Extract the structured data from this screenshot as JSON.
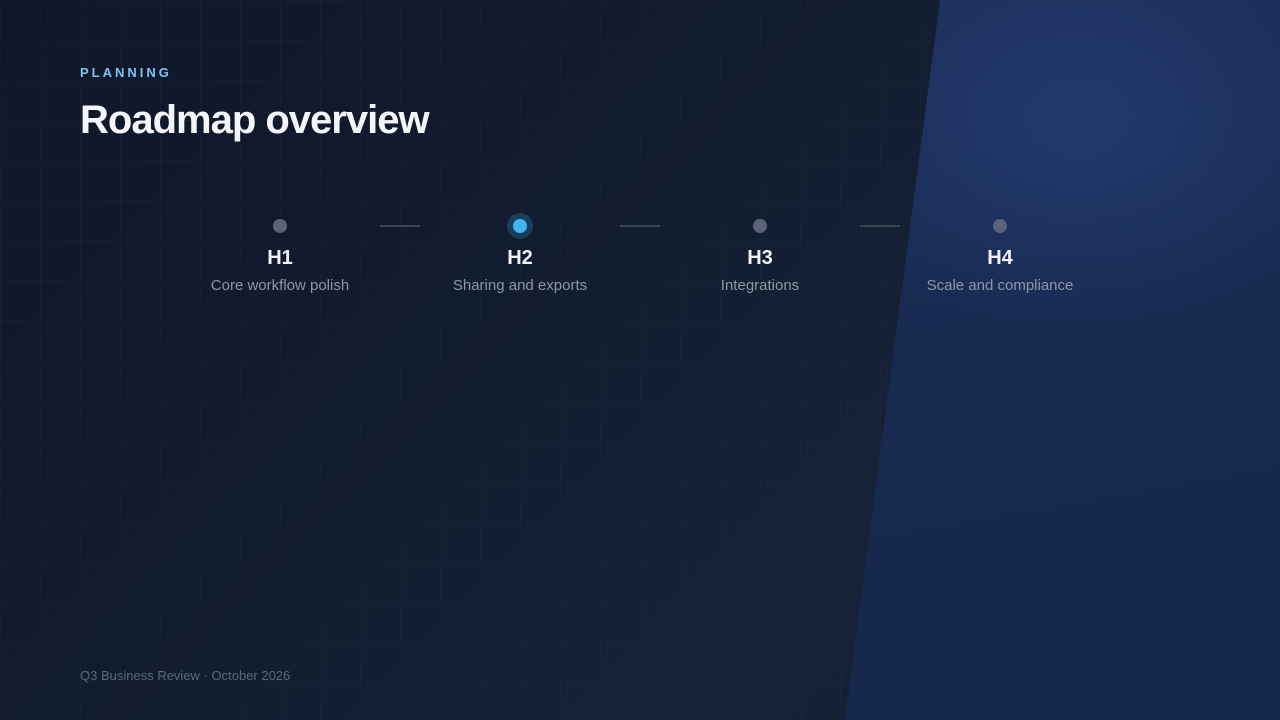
{
  "slide": {
    "eyebrow": "PLANNING",
    "title": "Roadmap overview",
    "footer": "Q3 Business Review · October 2026"
  },
  "timeline": {
    "active_index": 1,
    "colors": {
      "active": "#3fb3f6",
      "inactive": "#5b6478",
      "connector": "#3a4558"
    },
    "milestones": [
      {
        "label": "H1",
        "description": "Core workflow polish"
      },
      {
        "label": "H2",
        "description": "Sharing and exports"
      },
      {
        "label": "H3",
        "description": "Integrations"
      },
      {
        "label": "H4",
        "description": "Scale and compliance"
      }
    ]
  }
}
